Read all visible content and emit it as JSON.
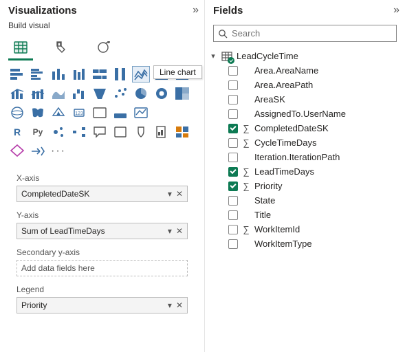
{
  "viz": {
    "title": "Visualizations",
    "subtitle": "Build visual",
    "tooltip": "Line chart",
    "xaxis_label": "X-axis",
    "xaxis_value": "CompletedDateSK",
    "yaxis_label": "Y-axis",
    "yaxis_value": "Sum of LeadTimeDays",
    "secondary_label": "Secondary y-axis",
    "secondary_placeholder": "Add data fields here",
    "legend_label": "Legend",
    "legend_value": "Priority"
  },
  "fields": {
    "title": "Fields",
    "search_placeholder": "Search",
    "table": "LeadCycleTime",
    "items": [
      {
        "name": "Area.AreaName",
        "checked": false,
        "sigma": false
      },
      {
        "name": "Area.AreaPath",
        "checked": false,
        "sigma": false
      },
      {
        "name": "AreaSK",
        "checked": false,
        "sigma": false
      },
      {
        "name": "AssignedTo.UserName",
        "checked": false,
        "sigma": false
      },
      {
        "name": "CompletedDateSK",
        "checked": true,
        "sigma": true
      },
      {
        "name": "CycleTimeDays",
        "checked": false,
        "sigma": true
      },
      {
        "name": "Iteration.IterationPath",
        "checked": false,
        "sigma": false
      },
      {
        "name": "LeadTimeDays",
        "checked": true,
        "sigma": true
      },
      {
        "name": "Priority",
        "checked": true,
        "sigma": true
      },
      {
        "name": "State",
        "checked": false,
        "sigma": false
      },
      {
        "name": "Title",
        "checked": false,
        "sigma": false
      },
      {
        "name": "WorkItemId",
        "checked": false,
        "sigma": true
      },
      {
        "name": "WorkItemType",
        "checked": false,
        "sigma": false
      }
    ]
  },
  "icons": {
    "row1": [
      "stacked-bar",
      "clustered-bar",
      "clustered-column",
      "stacked-column",
      "100-stacked-bar",
      "100-stacked-column",
      "line",
      "area",
      "stacked-area"
    ],
    "row2": [
      "line-clustered-column",
      "line-stacked-column",
      "ribbon",
      "waterfall",
      "funnel",
      "scatter",
      "pie",
      "donut",
      "treemap"
    ],
    "row3": [
      "map",
      "filled-map",
      "azure-map",
      "gauge",
      "card",
      "multi-row-card",
      "kpi",
      "slicer",
      "table"
    ],
    "row4": [
      "R",
      "Py",
      "key-influencers",
      "decomposition",
      "qa",
      "smart-narrative",
      "goals",
      "paginated",
      "power-automate"
    ],
    "row5": [
      "diamond",
      "arrow",
      "more"
    ]
  }
}
